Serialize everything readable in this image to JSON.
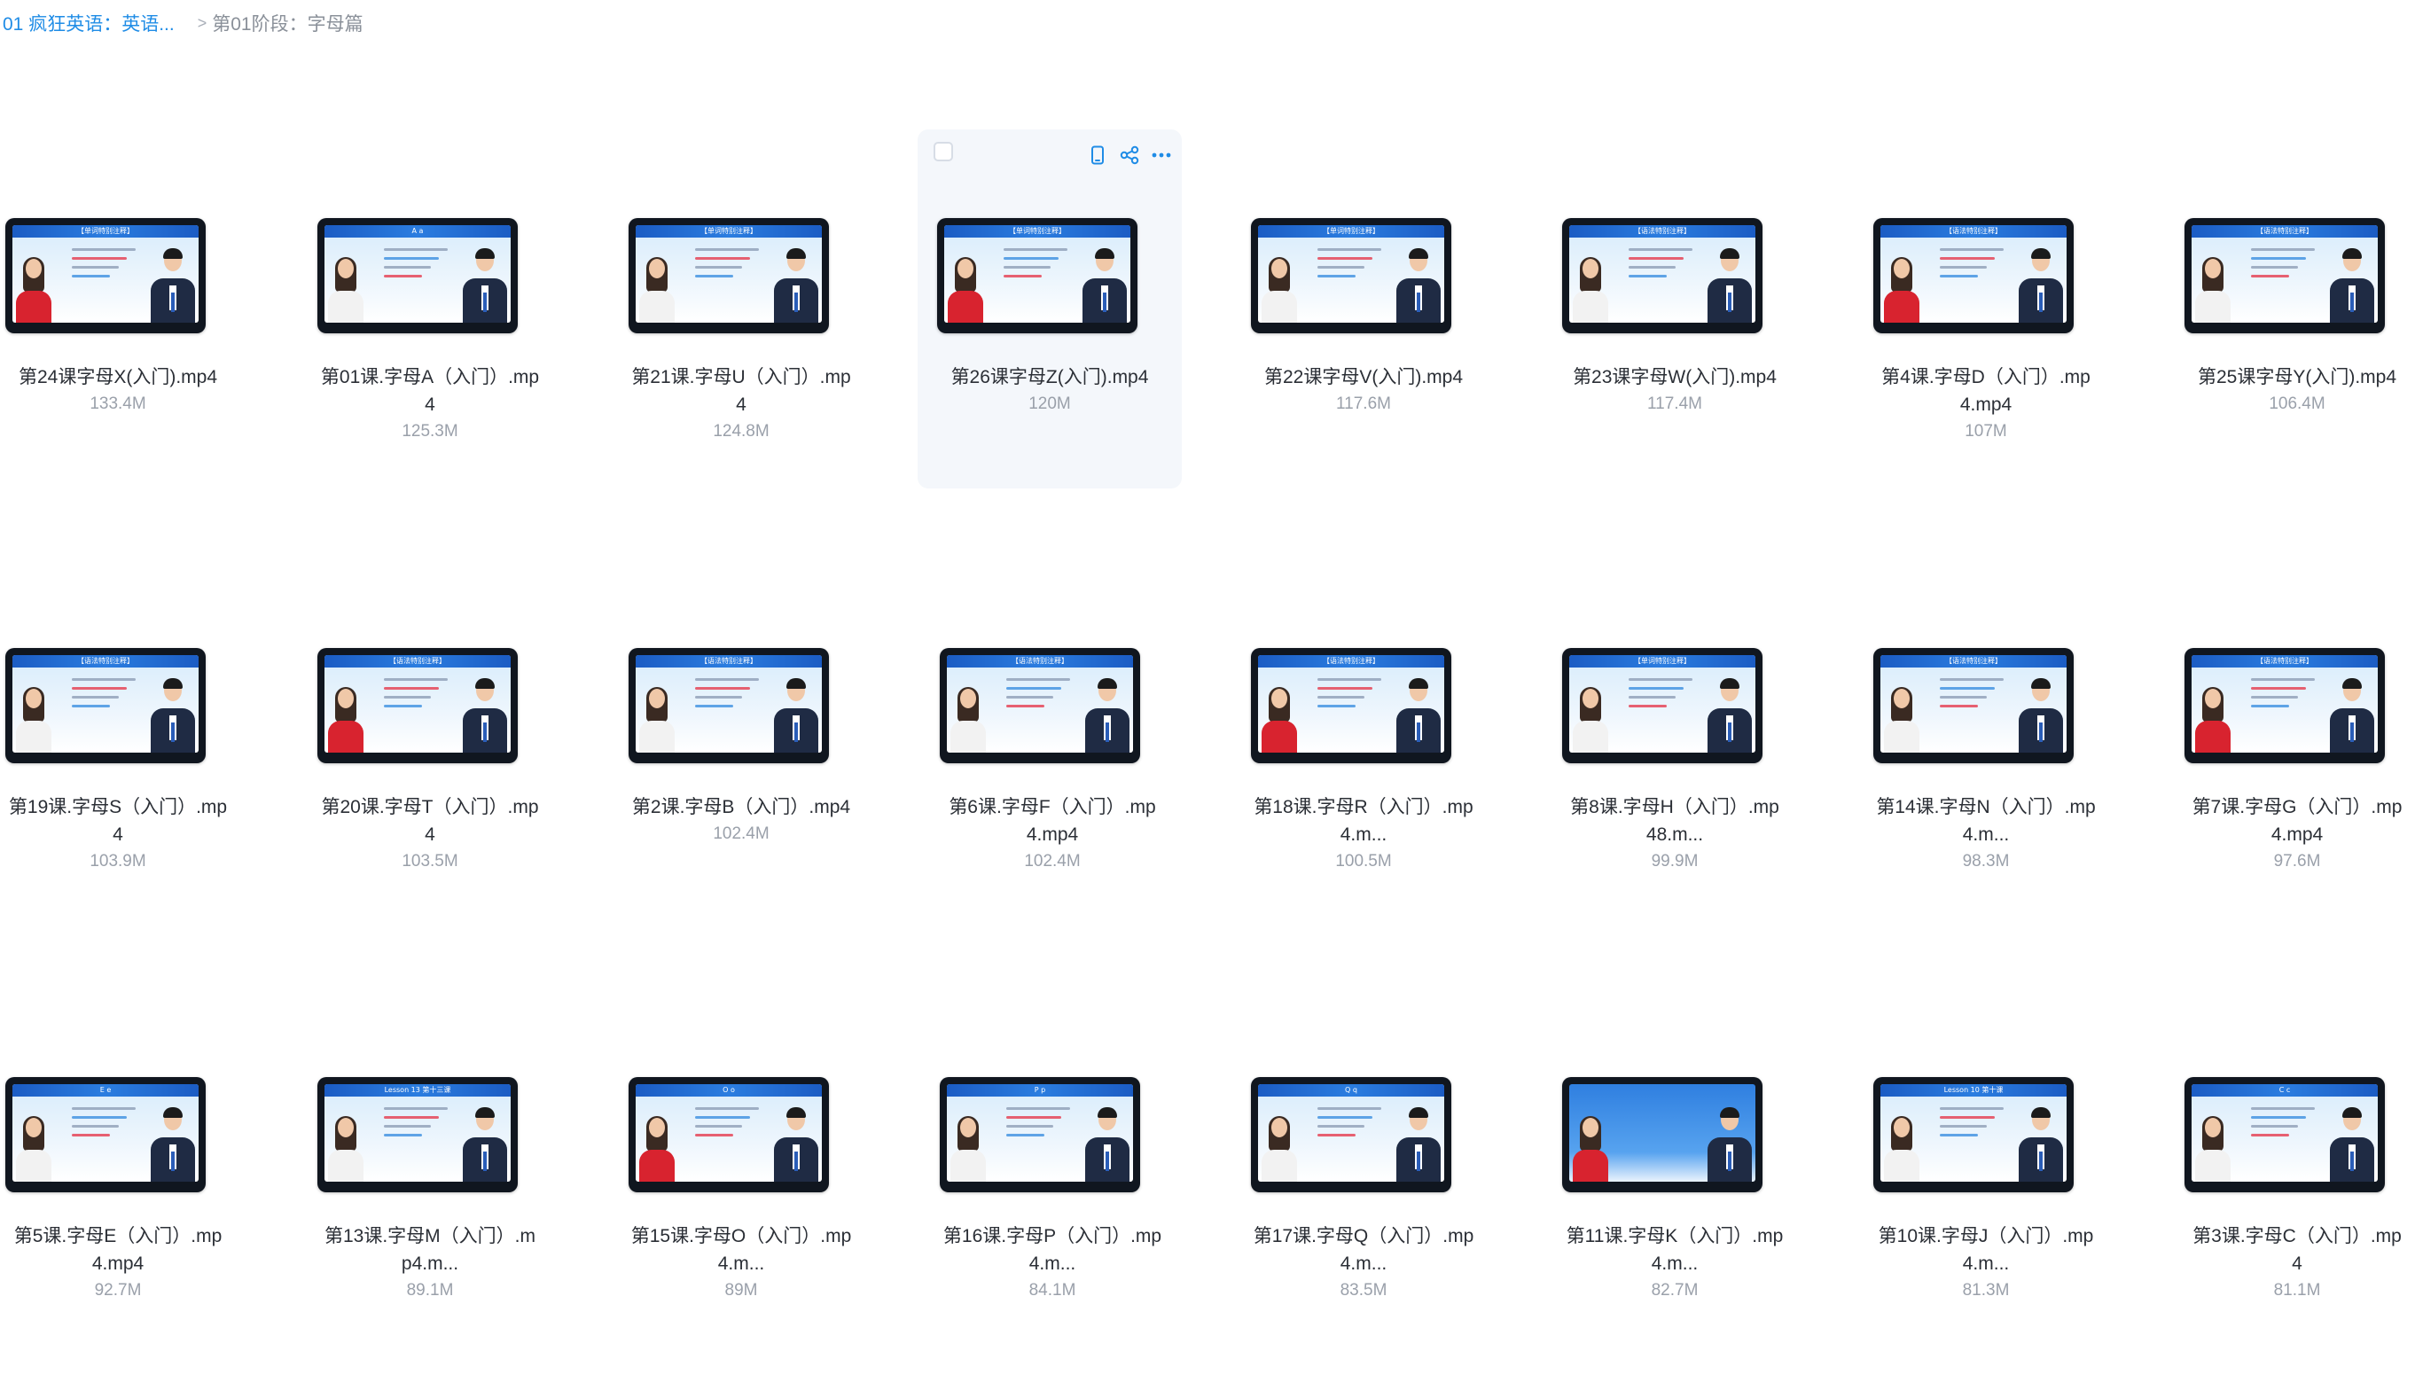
{
  "breadcrumb": {
    "root": "01 疯狂英语：英语...",
    "separator": ">",
    "current": "第01阶段：字母篇"
  },
  "colors": {
    "link": "#1f8ce6",
    "text": "#2b2f36",
    "muted": "#9aa0aa",
    "action_icon": "#1f8ce6",
    "hover_card_bg": "#f4f7fb"
  },
  "hover_actions": {
    "icons": [
      "phone-icon",
      "share-icon",
      "more-icon"
    ]
  },
  "files": [
    {
      "name_lines": [
        "第24课字母X(入门).mp4"
      ],
      "size": "133.4M",
      "thumb": {
        "header": "【单词特别注释】",
        "theme": "red"
      }
    },
    {
      "name_lines": [
        "第01课.字母A（入门）.mp",
        "4"
      ],
      "size": "125.3M",
      "thumb": {
        "header": "A a",
        "theme": "blue"
      }
    },
    {
      "name_lines": [
        "第21课.字母U（入门）.mp",
        "4"
      ],
      "size": "124.8M",
      "thumb": {
        "header": "【单词特别注释】",
        "theme": "red"
      }
    },
    {
      "name_lines": [
        "第26课字母Z(入门).mp4"
      ],
      "size": "120M",
      "hovered": true,
      "thumb": {
        "header": "【单词特别注释】",
        "theme": "blue"
      }
    },
    {
      "name_lines": [
        "第22课字母V(入门).mp4"
      ],
      "size": "117.6M",
      "thumb": {
        "header": "【单词特别注释】",
        "theme": "red"
      }
    },
    {
      "name_lines": [
        "第23课字母W(入门).mp4"
      ],
      "size": "117.4M",
      "thumb": {
        "header": "【语法特别注释】",
        "theme": "red"
      }
    },
    {
      "name_lines": [
        "第4课.字母D（入门）.mp",
        "4.mp4"
      ],
      "size": "107M",
      "thumb": {
        "header": "【语法特别注释】",
        "theme": "red"
      }
    },
    {
      "name_lines": [
        "第25课字母Y(入门).mp4"
      ],
      "size": "106.4M",
      "thumb": {
        "header": "【语法特别注释】",
        "theme": "blue"
      }
    },
    {
      "name_lines": [
        "第19课.字母S（入门）.mp",
        "4"
      ],
      "size": "103.9M",
      "thumb": {
        "header": "【语法特别注释】",
        "theme": "red"
      }
    },
    {
      "name_lines": [
        "第20课.字母T（入门）.mp",
        "4"
      ],
      "size": "103.5M",
      "thumb": {
        "header": "【语法特别注释】",
        "theme": "red"
      }
    },
    {
      "name_lines": [
        "第2课.字母B（入门）.mp4"
      ],
      "size": "102.4M",
      "thumb": {
        "header": "【语法特别注释】",
        "theme": "red"
      }
    },
    {
      "name_lines": [
        "第6课.字母F（入门）.mp",
        "4.mp4"
      ],
      "size": "102.4M",
      "thumb": {
        "header": "【语法特别注释】",
        "theme": "blue"
      }
    },
    {
      "name_lines": [
        "第18课.字母R（入门）.mp",
        "4.m..."
      ],
      "size": "100.5M",
      "thumb": {
        "header": "【语法特别注释】",
        "theme": "red"
      }
    },
    {
      "name_lines": [
        "第8课.字母H（入门）.mp",
        "48.m..."
      ],
      "size": "99.9M",
      "thumb": {
        "header": "【单词特别注释】",
        "theme": "blue"
      }
    },
    {
      "name_lines": [
        "第14课.字母N（入门）.mp",
        "4.m..."
      ],
      "size": "98.3M",
      "thumb": {
        "header": "【语法特别注释】",
        "theme": "blue"
      }
    },
    {
      "name_lines": [
        "第7课.字母G（入门）.mp",
        "4.mp4"
      ],
      "size": "97.6M",
      "thumb": {
        "header": "【语法特别注释】",
        "theme": "red"
      }
    },
    {
      "name_lines": [
        "第5课.字母E（入门）.mp",
        "4.mp4"
      ],
      "size": "92.7M",
      "thumb": {
        "header": "E e",
        "theme": "blue"
      }
    },
    {
      "name_lines": [
        "第13课.字母M（入门）.m",
        "p4.m..."
      ],
      "size": "89.1M",
      "thumb": {
        "header": "Lesson 13 第十三课",
        "theme": "red"
      }
    },
    {
      "name_lines": [
        "第15课.字母O（入门）.mp",
        "4.m..."
      ],
      "size": "89M",
      "thumb": {
        "header": "O o",
        "theme": "blue"
      }
    },
    {
      "name_lines": [
        "第16课.字母P（入门）.mp",
        "4.m..."
      ],
      "size": "84.1M",
      "thumb": {
        "header": "P p",
        "theme": "red"
      }
    },
    {
      "name_lines": [
        "第17课.字母Q（入门）.mp",
        "4.m..."
      ],
      "size": "83.5M",
      "thumb": {
        "header": "Q q",
        "theme": "blue"
      }
    },
    {
      "name_lines": [
        "第11课.字母K（入门）.mp",
        "4.m..."
      ],
      "size": "82.7M",
      "thumb": {
        "header": "",
        "theme": "solid"
      }
    },
    {
      "name_lines": [
        "第10课.字母J（入门）.mp",
        "4.m..."
      ],
      "size": "81.3M",
      "thumb": {
        "header": "Lesson 10 第十课",
        "theme": "red"
      }
    },
    {
      "name_lines": [
        "第3课.字母C（入门）.mp",
        "4"
      ],
      "size": "81.1M",
      "thumb": {
        "header": "C c",
        "theme": "blue"
      }
    }
  ]
}
